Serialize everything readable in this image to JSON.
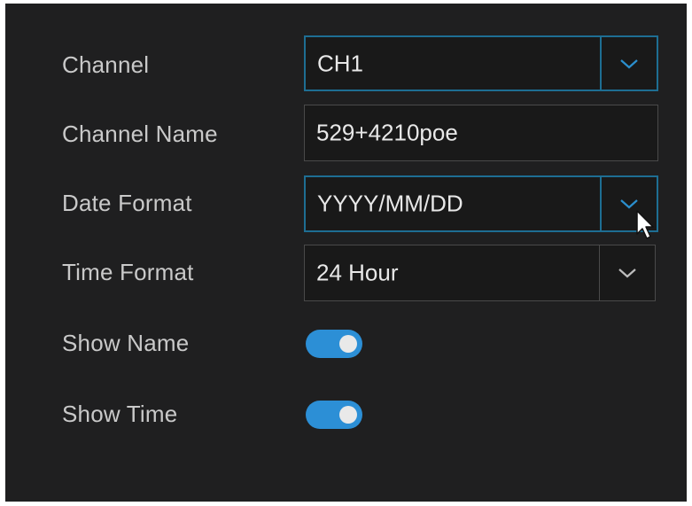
{
  "settings": {
    "channel": {
      "label": "Channel",
      "value": "CH1",
      "icon": "chevron-down-icon"
    },
    "channel_name": {
      "label": "Channel Name",
      "value": "529+4210poe"
    },
    "date_format": {
      "label": "Date Format",
      "value": "YYYY/MM/DD",
      "icon": "chevron-down-icon"
    },
    "time_format": {
      "label": "Time Format",
      "value": "24 Hour",
      "icon": "chevron-down-icon"
    },
    "show_name": {
      "label": "Show Name",
      "on": true
    },
    "show_time": {
      "label": "Show Time",
      "on": true
    }
  },
  "colors": {
    "panel_background": "#1f1f20",
    "field_background": "#191919",
    "active_border": "#1e6e93",
    "toggle_on": "#2c8fd6",
    "chevron_active": "#2b8fce",
    "chevron_default": "#bdbdbd"
  }
}
